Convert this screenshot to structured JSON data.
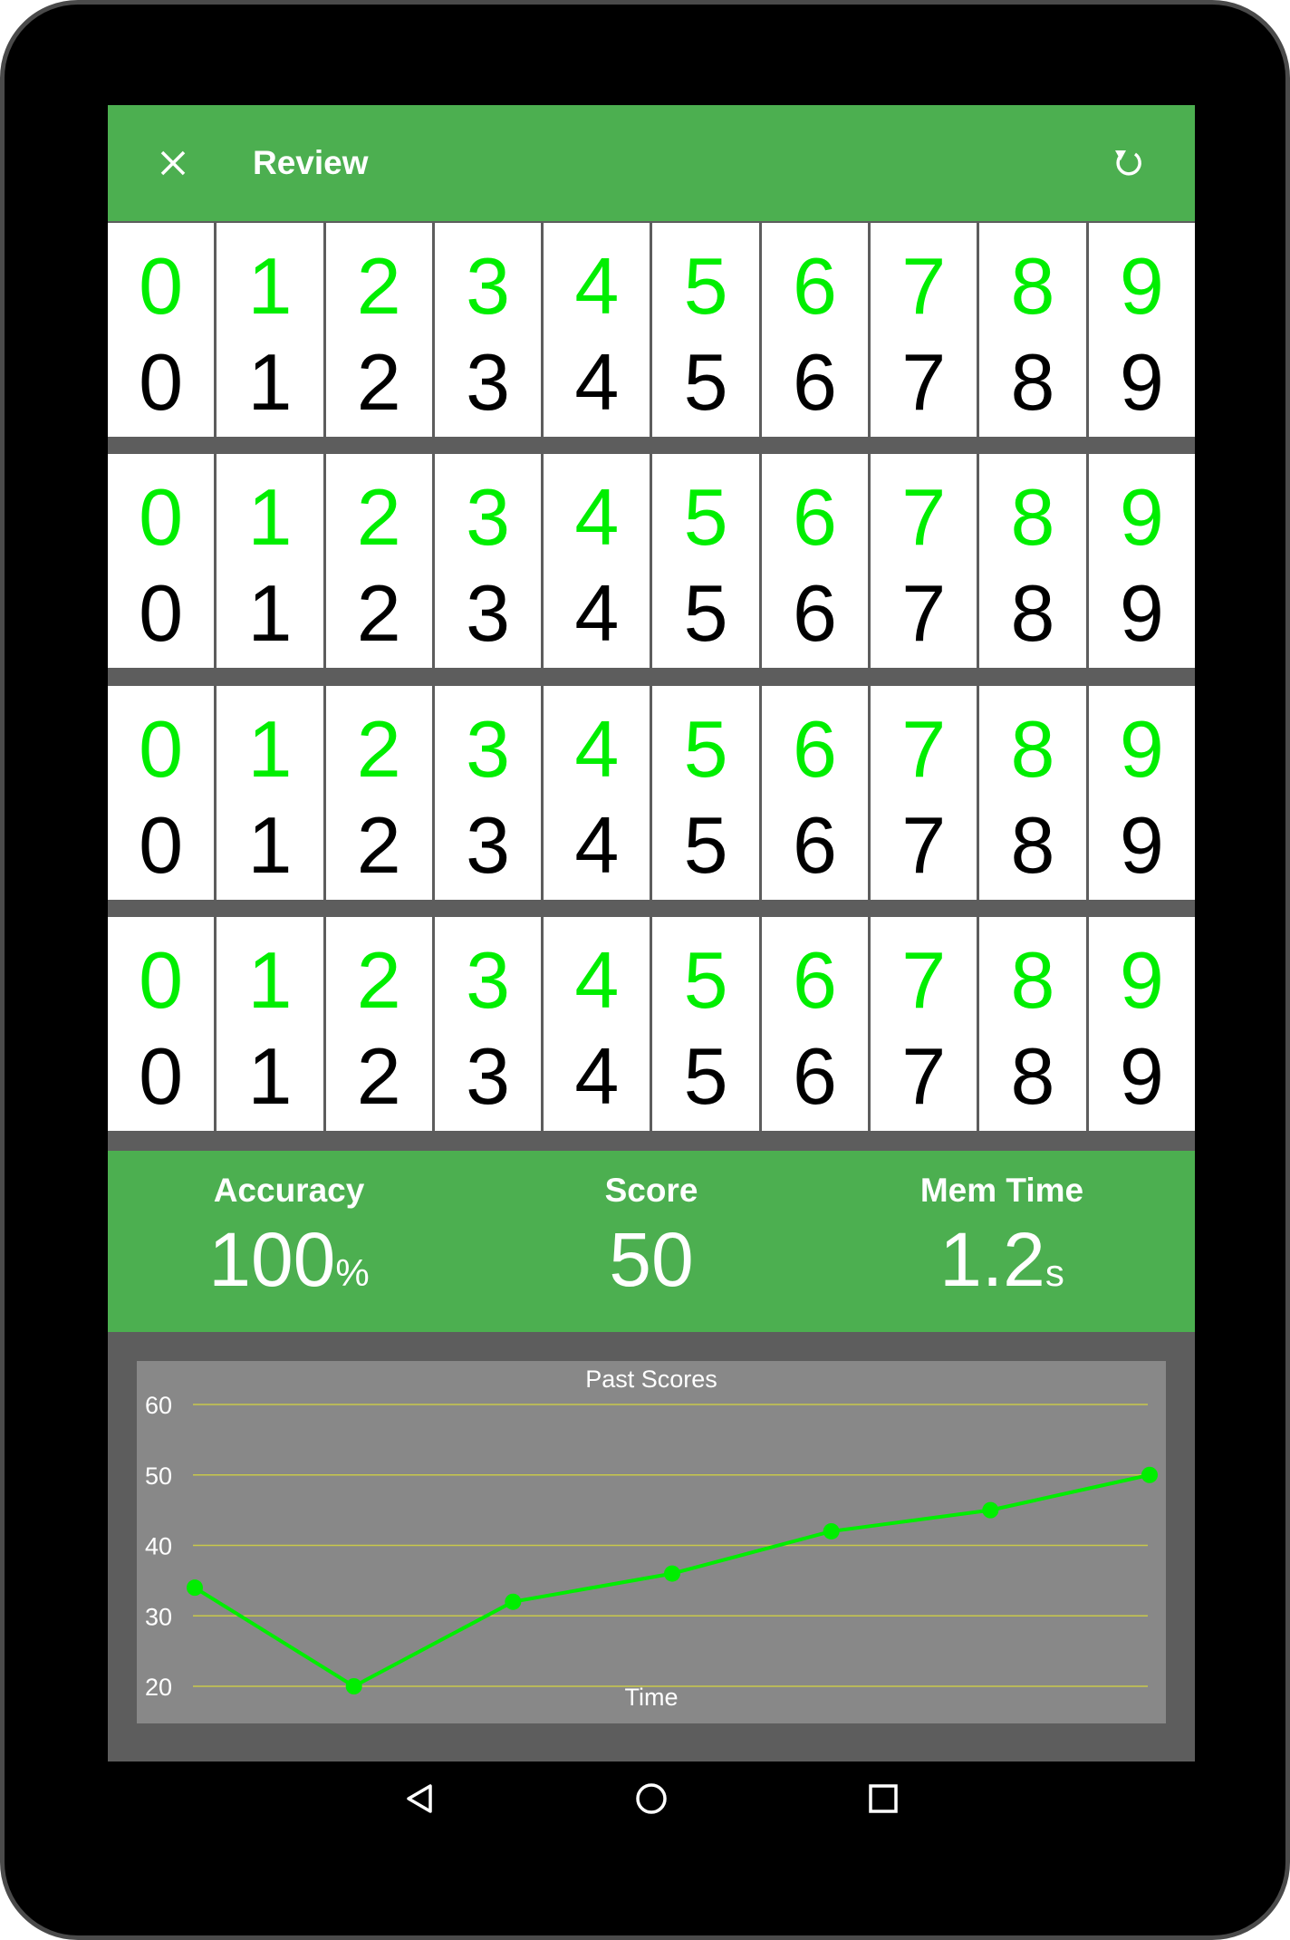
{
  "app_bar": {
    "title": "Review",
    "close_icon": "close-icon",
    "refresh_icon": "refresh-icon",
    "color": "#4caf50"
  },
  "grid": {
    "rows": [
      {
        "cells": [
          {
            "top": "0",
            "bottom": "0"
          },
          {
            "top": "1",
            "bottom": "1"
          },
          {
            "top": "2",
            "bottom": "2"
          },
          {
            "top": "3",
            "bottom": "3"
          },
          {
            "top": "4",
            "bottom": "4"
          },
          {
            "top": "5",
            "bottom": "5"
          },
          {
            "top": "6",
            "bottom": "6"
          },
          {
            "top": "7",
            "bottom": "7"
          },
          {
            "top": "8",
            "bottom": "8"
          },
          {
            "top": "9",
            "bottom": "9"
          }
        ]
      },
      {
        "cells": [
          {
            "top": "0",
            "bottom": "0"
          },
          {
            "top": "1",
            "bottom": "1"
          },
          {
            "top": "2",
            "bottom": "2"
          },
          {
            "top": "3",
            "bottom": "3"
          },
          {
            "top": "4",
            "bottom": "4"
          },
          {
            "top": "5",
            "bottom": "5"
          },
          {
            "top": "6",
            "bottom": "6"
          },
          {
            "top": "7",
            "bottom": "7"
          },
          {
            "top": "8",
            "bottom": "8"
          },
          {
            "top": "9",
            "bottom": "9"
          }
        ]
      },
      {
        "cells": [
          {
            "top": "0",
            "bottom": "0"
          },
          {
            "top": "1",
            "bottom": "1"
          },
          {
            "top": "2",
            "bottom": "2"
          },
          {
            "top": "3",
            "bottom": "3"
          },
          {
            "top": "4",
            "bottom": "4"
          },
          {
            "top": "5",
            "bottom": "5"
          },
          {
            "top": "6",
            "bottom": "6"
          },
          {
            "top": "7",
            "bottom": "7"
          },
          {
            "top": "8",
            "bottom": "8"
          },
          {
            "top": "9",
            "bottom": "9"
          }
        ]
      },
      {
        "cells": [
          {
            "top": "0",
            "bottom": "0"
          },
          {
            "top": "1",
            "bottom": "1"
          },
          {
            "top": "2",
            "bottom": "2"
          },
          {
            "top": "3",
            "bottom": "3"
          },
          {
            "top": "4",
            "bottom": "4"
          },
          {
            "top": "5",
            "bottom": "5"
          },
          {
            "top": "6",
            "bottom": "6"
          },
          {
            "top": "7",
            "bottom": "7"
          },
          {
            "top": "8",
            "bottom": "8"
          },
          {
            "top": "9",
            "bottom": "9"
          }
        ]
      }
    ],
    "correct_color": "#00ee00",
    "answer_color": "#000000"
  },
  "stats": {
    "accuracy": {
      "label": "Accuracy",
      "value": "100",
      "unit": "%"
    },
    "score": {
      "label": "Score",
      "value": "50"
    },
    "mem_time": {
      "label": "Mem Time",
      "value": "1.2",
      "unit": "s"
    }
  },
  "chart_data": {
    "type": "line",
    "title": "Past Scores",
    "xlabel": "Time",
    "ylabel": "",
    "ylim": [
      20,
      60
    ],
    "yticks": [
      "60",
      "50",
      "40",
      "30",
      "20"
    ],
    "grid": true,
    "series": [
      {
        "values": [
          34,
          20,
          32,
          36,
          42,
          45,
          50
        ]
      }
    ],
    "line_color": "#00ee00",
    "grid_color": "#c8c84a",
    "background_color": "#888888"
  },
  "nav_bar": {
    "back_icon": "back-triangle-icon",
    "home_icon": "home-circle-icon",
    "recents_icon": "recents-square-icon"
  }
}
